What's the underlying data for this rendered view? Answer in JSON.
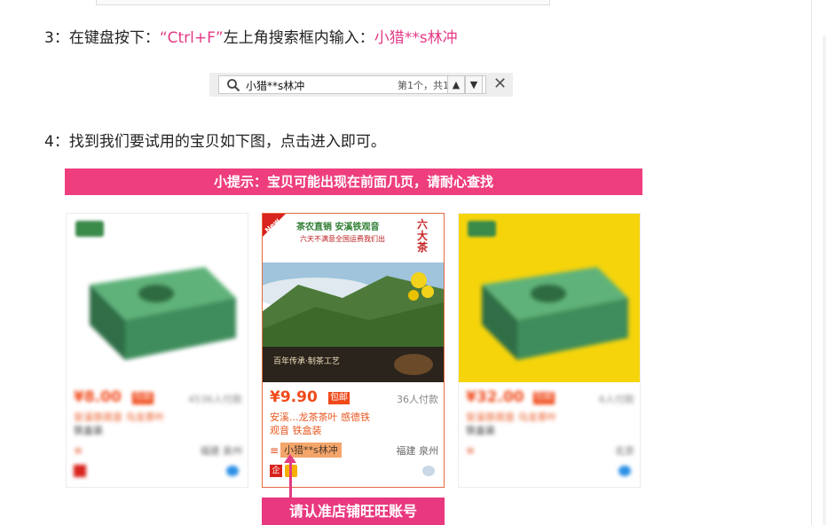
{
  "step3": {
    "prefix": "3：在键盘按下：",
    "shortcut": "“Ctrl+F”",
    "middle": "左上角搜索框内输入：",
    "keyword": "小猎**s林冲"
  },
  "find_bar": {
    "query": "小猎**s林冲",
    "match_count": "第1个，共1个",
    "prev_glyph": "▲",
    "next_glyph": "▼",
    "close_glyph": "✕"
  },
  "step4": {
    "text": "4：找到我们要试用的宝贝如下图，点击进入即可。"
  },
  "tip_banner": "小提示：宝贝可能出现在前面几页，请耐心查找",
  "products": [
    {
      "price": "¥8.00",
      "badge": "包邮",
      "paid": "4536人付款",
      "title_line1": "安溪铁观音 乌龙茶叶",
      "title_line2": "铁盒装",
      "shop": "",
      "location": "福建 泉州"
    },
    {
      "price": "¥9.90",
      "badge": "包邮",
      "paid": "36人付款",
      "title_line1": "安溪...龙茶茶叶 感德铁",
      "title_line2": "观音 铁盒装",
      "shop": "小猎**s林冲",
      "location": "福建 泉州",
      "qi": "企"
    },
    {
      "price": "¥32.00",
      "badge": "包邮",
      "paid": "6人付款",
      "title_line1": "安溪铁观音 乌龙茶叶",
      "title_line2": "铁盒装",
      "shop": "",
      "location": "北京"
    }
  ],
  "image_text": {
    "line1": "茶农直销 安溪铁观音",
    "line2": "六天不满意全国运费我们出",
    "side": "六大茶",
    "corner": "New",
    "bottom_caption": "百年传承·制茶工艺"
  },
  "note_banner": "请认准店铺旺旺账号",
  "colors": {
    "pink": "#e33a86",
    "banner_pink": "#ee3e7e",
    "price_orange": "#f04a1a",
    "highlight_orange": "#f4a56a"
  }
}
